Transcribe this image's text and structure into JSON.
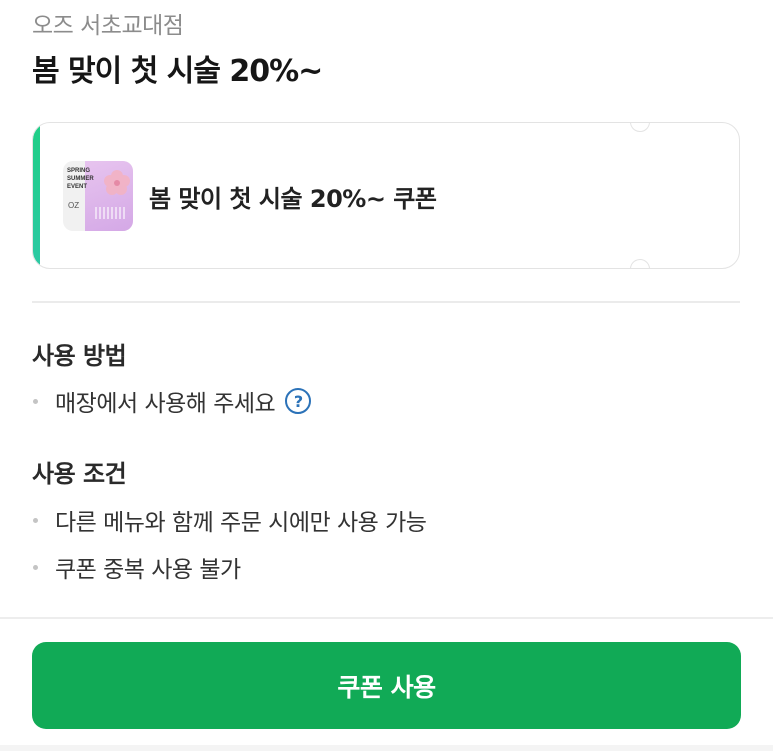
{
  "header": {
    "store_name": "오즈 서초교대점",
    "title": "봄 맞이 첫 시술 20%~"
  },
  "coupon": {
    "name": "봄 맞이 첫 시술 20%~ 쿠폰",
    "thumbnail_text": [
      "SPRING",
      "SUMMER",
      "EVENT"
    ],
    "thumbnail_logo": "OZ",
    "accent_color": "#1fce86"
  },
  "usage_method": {
    "title": "사용 방법",
    "items": [
      {
        "text": "매장에서 사용해 주세요",
        "help_icon": "question-circle-icon"
      }
    ]
  },
  "usage_conditions": {
    "title": "사용 조건",
    "items": [
      "다른 메뉴와 함께 주문 시에만 사용 가능",
      "쿠폰 중복 사용 불가"
    ]
  },
  "action": {
    "use_button_label": "쿠폰 사용",
    "button_color": "#11aa56"
  }
}
